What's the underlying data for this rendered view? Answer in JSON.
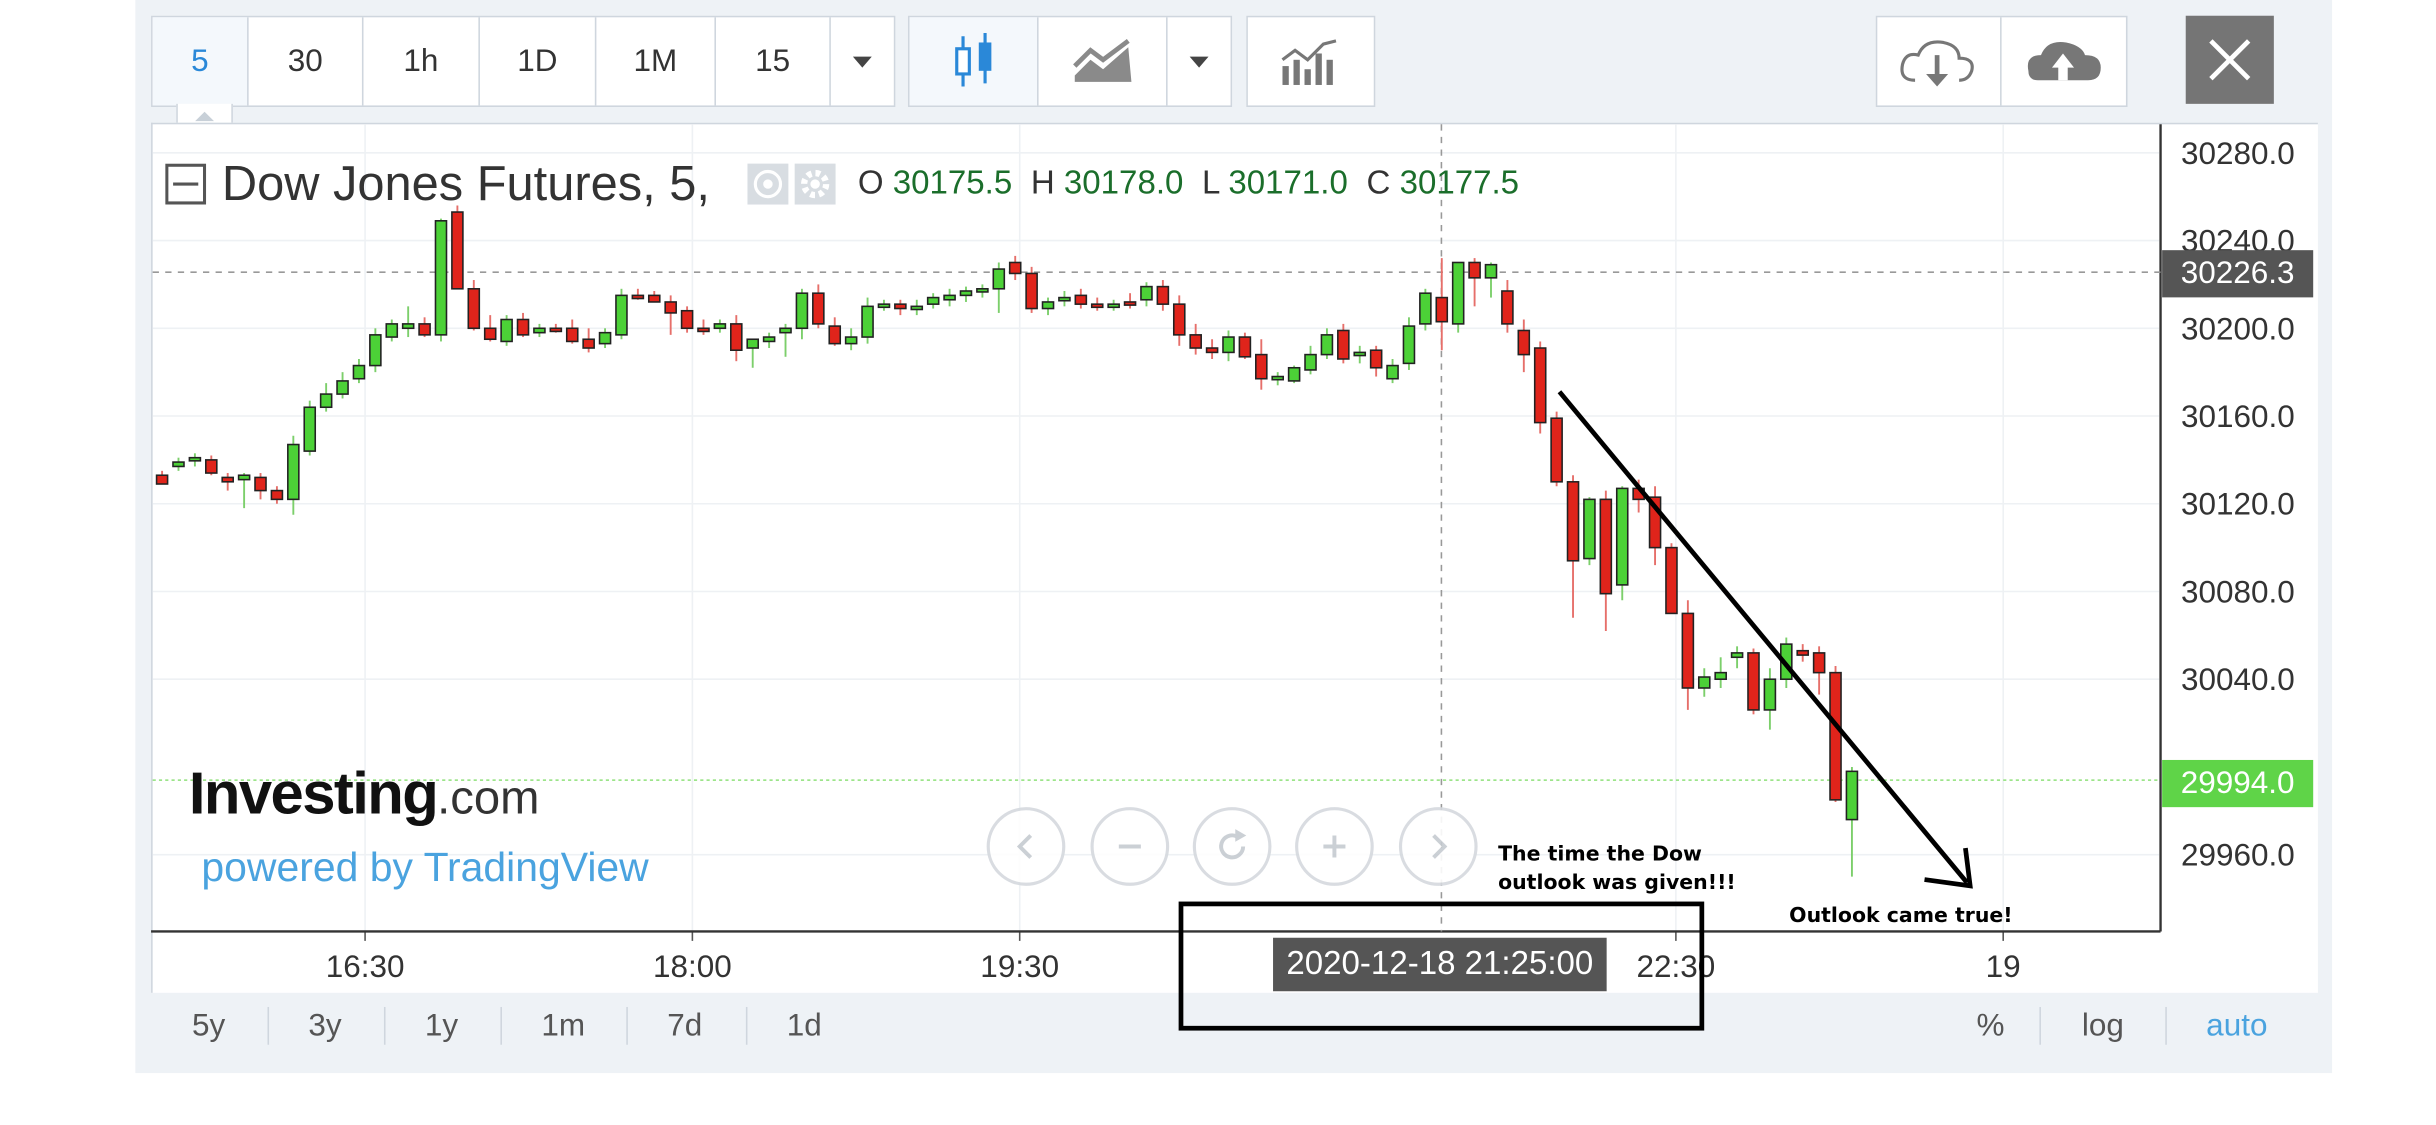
{
  "toolbar": {
    "intervals": [
      "5",
      "30",
      "1h",
      "1D",
      "1M",
      "15"
    ],
    "active_interval": "5"
  },
  "legend": {
    "title": "Dow Jones Futures, 5,",
    "o_label": "O",
    "o_value": "30175.5",
    "h_label": "H",
    "h_value": "30178.0",
    "l_label": "L",
    "l_value": "30171.0",
    "c_label": "C",
    "c_value": "30177.5"
  },
  "price_tags": {
    "crosshair": "30226.3",
    "last": "29994.0"
  },
  "crosshair_time": "2020-12-18 21:25:00",
  "brand": {
    "name_main": "Investing",
    "name_suffix": ".com",
    "powered_by": "powered by TradingView"
  },
  "ranges": [
    "5y",
    "3y",
    "1y",
    "1m",
    "7d",
    "1d"
  ],
  "scale_options": [
    "%",
    "log",
    "auto"
  ],
  "annotations": {
    "note1_line1": "The time the Dow",
    "note1_line2": "outlook was given!!!",
    "note2": "Outlook came true!"
  },
  "colors": {
    "up": "#4cd137",
    "down": "#e0241b",
    "accent": "#2a88d8",
    "last_price": "#5fd448",
    "crosshair_tag": "#555555"
  },
  "chart_data": {
    "type": "candlestick",
    "title": "Dow Jones Futures, 5,",
    "y_ticks": [
      30280.0,
      30240.0,
      30200.0,
      30160.0,
      30120.0,
      30080.0,
      30040.0,
      29960.0
    ],
    "x_ticks": [
      "16:30",
      "18:00",
      "19:30",
      "22:30",
      "19"
    ],
    "ylim": [
      29925,
      30293
    ],
    "candles": [
      [
        30133,
        30135,
        30131,
        30129
      ],
      [
        30137,
        30141,
        30135,
        30139
      ],
      [
        30140,
        30143,
        30137,
        30141
      ],
      [
        30140,
        30142,
        30133,
        30134
      ],
      [
        30132,
        30134,
        30126,
        30130
      ],
      [
        30131,
        30134,
        30118,
        30133
      ],
      [
        30132,
        30134,
        30122,
        30126
      ],
      [
        30126,
        30128,
        30120,
        30122
      ],
      [
        30122,
        30151,
        30115,
        30147
      ],
      [
        30144,
        30167,
        30142,
        30164
      ],
      [
        30164,
        30175,
        30162,
        30170
      ],
      [
        30170,
        30180,
        30168,
        30176
      ],
      [
        30177,
        30186,
        30175,
        30183
      ],
      [
        30183,
        30200,
        30180,
        30197
      ],
      [
        30196,
        30204,
        30194,
        30202
      ],
      [
        30200,
        30210,
        30196,
        30202
      ],
      [
        30202,
        30205,
        30196,
        30197
      ],
      [
        30197,
        30250,
        30194,
        30249
      ],
      [
        30253,
        30256,
        30218,
        30218
      ],
      [
        30218,
        30222,
        30199,
        30200
      ],
      [
        30200,
        30206,
        30194,
        30195
      ],
      [
        30194,
        30206,
        30192,
        30204
      ],
      [
        30204,
        30207,
        30196,
        30197
      ],
      [
        30198,
        30202,
        30196,
        30200
      ],
      [
        30200,
        30202,
        30198,
        30199
      ],
      [
        30200,
        30204,
        30193,
        30194
      ],
      [
        30195,
        30200,
        30189,
        30191
      ],
      [
        30193,
        30200,
        30191,
        30198
      ],
      [
        30197,
        30218,
        30195,
        30215
      ],
      [
        30215,
        30218,
        30213,
        30214
      ],
      [
        30215,
        30217,
        30213,
        30212
      ],
      [
        30212,
        30215,
        30197,
        30207
      ],
      [
        30208,
        30210,
        30198,
        30200
      ],
      [
        30200,
        30204,
        30197,
        30199
      ],
      [
        30200,
        30204,
        30198,
        30202
      ],
      [
        30202,
        30206,
        30185,
        30190
      ],
      [
        30191,
        30195,
        30182,
        30195
      ],
      [
        30194,
        30198,
        30191,
        30196
      ],
      [
        30198,
        30202,
        30187,
        30200
      ],
      [
        30200,
        30218,
        30195,
        30216
      ],
      [
        30216,
        30220,
        30200,
        30202
      ],
      [
        30201,
        30205,
        30192,
        30193
      ],
      [
        30193,
        30200,
        30190,
        30196
      ],
      [
        30196,
        30214,
        30193,
        30210
      ],
      [
        30210,
        30213,
        30208,
        30211
      ],
      [
        30211,
        30213,
        30206,
        30209
      ],
      [
        30209,
        30213,
        30206,
        30210
      ],
      [
        30211,
        30216,
        30209,
        30214
      ],
      [
        30213,
        30218,
        30210,
        30215
      ],
      [
        30215,
        30219,
        30212,
        30217
      ],
      [
        30217,
        30220,
        30214,
        30218
      ],
      [
        30218,
        30230,
        30207,
        30227
      ],
      [
        30230,
        30233,
        30222,
        30225
      ],
      [
        30225,
        30228,
        30207,
        30209
      ],
      [
        30209,
        30214,
        30206,
        30212
      ],
      [
        30213,
        30217,
        30210,
        30214
      ],
      [
        30215,
        30218,
        30209,
        30211
      ],
      [
        30211,
        30214,
        30208,
        30210
      ],
      [
        30210,
        30213,
        30208,
        30211
      ],
      [
        30212,
        30216,
        30209,
        30211
      ],
      [
        30213,
        30221,
        30210,
        30219
      ],
      [
        30219,
        30222,
        30208,
        30211
      ],
      [
        30211,
        30215,
        30192,
        30197
      ],
      [
        30197,
        30202,
        30188,
        30191
      ],
      [
        30191,
        30195,
        30186,
        30189
      ],
      [
        30189,
        30199,
        30185,
        30196
      ],
      [
        30196,
        30198,
        30186,
        30187
      ],
      [
        30188,
        30195,
        30172,
        30177
      ],
      [
        30177,
        30180,
        30174,
        30178
      ],
      [
        30176,
        30183,
        30175,
        30182
      ],
      [
        30181,
        30192,
        30179,
        30188
      ],
      [
        30188,
        30200,
        30186,
        30197
      ],
      [
        30199,
        30202,
        30184,
        30186
      ],
      [
        30188,
        30192,
        30184,
        30189
      ],
      [
        30190,
        30192,
        30178,
        30182
      ],
      [
        30177,
        30186,
        30175,
        30183
      ],
      [
        30184,
        30205,
        30181,
        30201
      ],
      [
        30202,
        30218,
        30199,
        30216
      ],
      [
        30214,
        30232,
        30190,
        30203
      ],
      [
        30202,
        30230,
        30198,
        30230
      ],
      [
        30230,
        30232,
        30210,
        30223
      ],
      [
        30223,
        30230,
        30214,
        30229
      ],
      [
        30217,
        30222,
        30198,
        30202
      ],
      [
        30199,
        30204,
        30180,
        30188
      ],
      [
        30191,
        30194,
        30152,
        30157
      ],
      [
        30159,
        30162,
        30128,
        30130
      ],
      [
        30130,
        30133,
        30068,
        30094
      ],
      [
        30095,
        30123,
        30092,
        30122
      ],
      [
        30122,
        30126,
        30062,
        30079
      ],
      [
        30083,
        30128,
        30076,
        30127
      ],
      [
        30127,
        30131,
        30116,
        30122
      ],
      [
        30123,
        30128,
        30092,
        30100
      ],
      [
        30100,
        30102,
        30070,
        30070
      ],
      [
        30070,
        30076,
        30026,
        30036
      ],
      [
        30036,
        30045,
        30032,
        30041
      ],
      [
        30040,
        30050,
        30036,
        30043
      ],
      [
        30050,
        30055,
        30045,
        30052
      ],
      [
        30052,
        30054,
        30024,
        30026
      ],
      [
        30026,
        30045,
        30017,
        30040
      ],
      [
        30040,
        30059,
        30036,
        30056
      ],
      [
        30053,
        30056,
        30048,
        30051
      ],
      [
        30052,
        30055,
        30033,
        30043
      ],
      [
        30043,
        30046,
        29984,
        29985
      ],
      [
        29976,
        30000,
        29950,
        29998
      ]
    ]
  }
}
